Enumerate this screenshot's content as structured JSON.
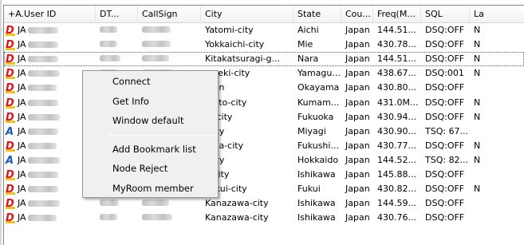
{
  "columns": {
    "user_id": "+A.User ID",
    "dt": "DT...",
    "callsign": "CallSign",
    "city": "City",
    "state": "State",
    "country": "Cou...",
    "freq": "Freq(M...",
    "sql": "SQL",
    "last": "La"
  },
  "rows": [
    {
      "badge": "D",
      "user": "JA",
      "city": "Yatomi-city",
      "state": "Aichi",
      "country": "Japan",
      "freq": "144.51...",
      "sql": "DSQ:OFF",
      "last": "N"
    },
    {
      "badge": "D",
      "user": "JA",
      "city": "Yokkaichi-city",
      "state": "Mie",
      "country": "Japan",
      "freq": "430.78...",
      "sql": "DSQ:OFF",
      "last": "N"
    },
    {
      "badge": "D",
      "user": "JA",
      "city": "Kitakatsuragi-g...",
      "state": "Nara",
      "country": "Japan",
      "freq": "144.51...",
      "sql": "DSQ:OFF",
      "last": "N"
    },
    {
      "badge": "D",
      "user": "JA",
      "city": "...seki-city",
      "state": "Yamagu...",
      "country": "Japan",
      "freq": "438.67...",
      "sql": "DSQ:001",
      "last": "N"
    },
    {
      "badge": "D",
      "user": "JA",
      "city": "...un",
      "state": "Okayama",
      "country": "Japan",
      "freq": "430.80...",
      "sql": "DSQ:OFF",
      "last": ""
    },
    {
      "badge": "D",
      "user": "JA",
      "city": "...oto-city",
      "state": "Kumam...",
      "country": "Japan",
      "freq": "431.0M...",
      "sql": "DSQ:OFF",
      "last": "N"
    },
    {
      "badge": "D",
      "user": "JA",
      "city": "...-city",
      "state": "Fukuoka",
      "country": "Japan",
      "freq": "430.94...",
      "sql": "DSQ:OFF",
      "last": "N"
    },
    {
      "badge": "A",
      "user": "JA",
      "city": "...ity",
      "state": "Miyagi",
      "country": "Japan",
      "freq": "430.90...",
      "sql": "TSQ: 67...",
      "last": ""
    },
    {
      "badge": "D",
      "user": "JA",
      "city": "...na-city",
      "state": "Fukushi...",
      "country": "Japan",
      "freq": "430.77...",
      "sql": "DSQ:OFF",
      "last": "N"
    },
    {
      "badge": "A",
      "user": "JA",
      "city": "...ity",
      "state": "Hokkaido",
      "country": "Japan",
      "freq": "144.52...",
      "sql": "TSQ: 82...",
      "last": "N"
    },
    {
      "badge": "D",
      "user": "JA",
      "city": "...city",
      "state": "Ishikawa",
      "country": "Japan",
      "freq": "145.88...",
      "sql": "DSQ:OFF",
      "last": ""
    },
    {
      "badge": "D",
      "user": "JA",
      "city": "Fukui-city",
      "state": "Fukui",
      "country": "Japan",
      "freq": "430.82...",
      "sql": "DSQ:OFF",
      "last": "N"
    },
    {
      "badge": "D",
      "user": "JA",
      "city": "Kanazawa-city",
      "state": "Ishikawa",
      "country": "Japan",
      "freq": "144.59...",
      "sql": "DSQ:OFF",
      "last": ""
    },
    {
      "badge": "D",
      "user": "JA",
      "city": "Kanazawa-city",
      "state": "Ishikawa",
      "country": "Japan",
      "freq": "430.76...",
      "sql": "DSQ:OFF",
      "last": ""
    }
  ],
  "context_menu": {
    "connect": "Connect",
    "get_info": "Get Info",
    "window_default": "Window default",
    "add_bookmark": "Add Bookmark list",
    "node_reject": "Node Reject",
    "myroom_member": "MyRoom member"
  },
  "colors": {
    "digital_badge": "#e1121a",
    "analog_badge": "#1a55c8",
    "badge_stripe": "#f3c21b"
  }
}
